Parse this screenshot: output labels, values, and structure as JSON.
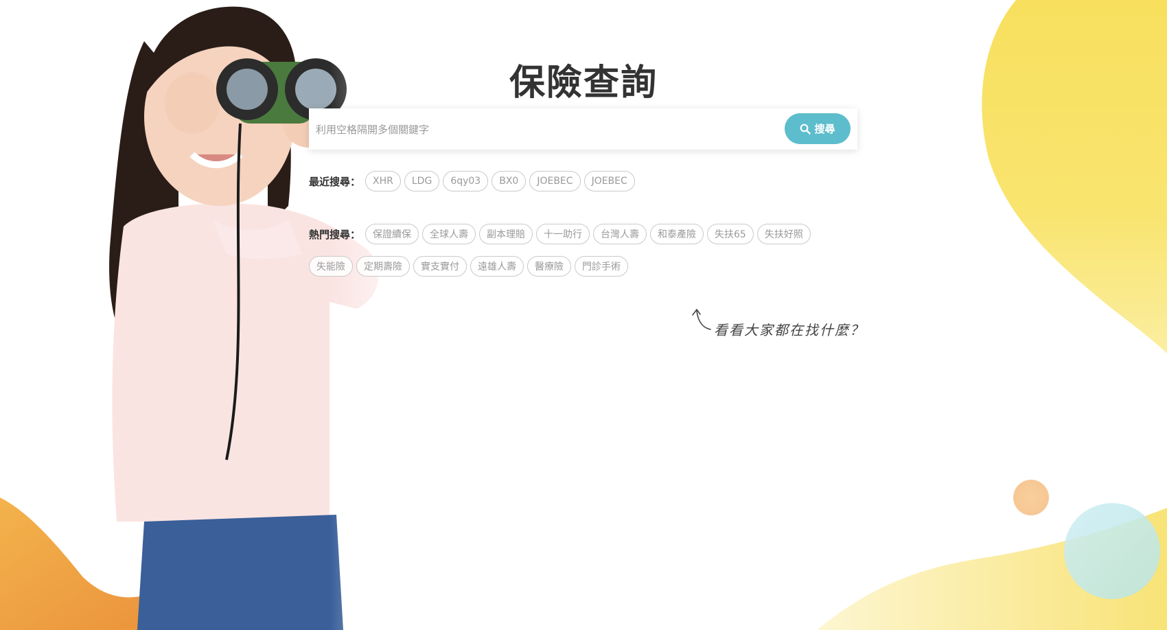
{
  "header": {
    "title": "保險查詢"
  },
  "search": {
    "placeholder": "利用空格隔開多個關鍵字",
    "value": "",
    "button_label": "搜尋"
  },
  "recent": {
    "label": "最近搜尋：",
    "tags": [
      "XHR",
      "LDG",
      "6qy03",
      "BX0",
      "JOEBEC",
      "JOEBEC"
    ]
  },
  "popular": {
    "label": "熱門搜尋：",
    "tags_row1": [
      "保證續保",
      "全球人壽",
      "副本理賠",
      "十一助行",
      "台灣人壽",
      "和泰產險",
      "失扶65",
      "失扶好照"
    ],
    "tags_row2": [
      "失能險",
      "定期壽險",
      "實支實付",
      "遠雄人壽",
      "醫療險",
      "門診手術"
    ]
  },
  "hint": {
    "text": "看看大家都在找什麼？"
  },
  "colors": {
    "accent": "#5dbdcc",
    "yellow": "#f7e163",
    "orange": "#f0a847",
    "terracotta": "#d9683f",
    "peach": "#f5c99a",
    "aqua": "#bfe6ea"
  },
  "icons": {
    "search": "search-icon",
    "arrow": "arrow-up-left-icon"
  }
}
